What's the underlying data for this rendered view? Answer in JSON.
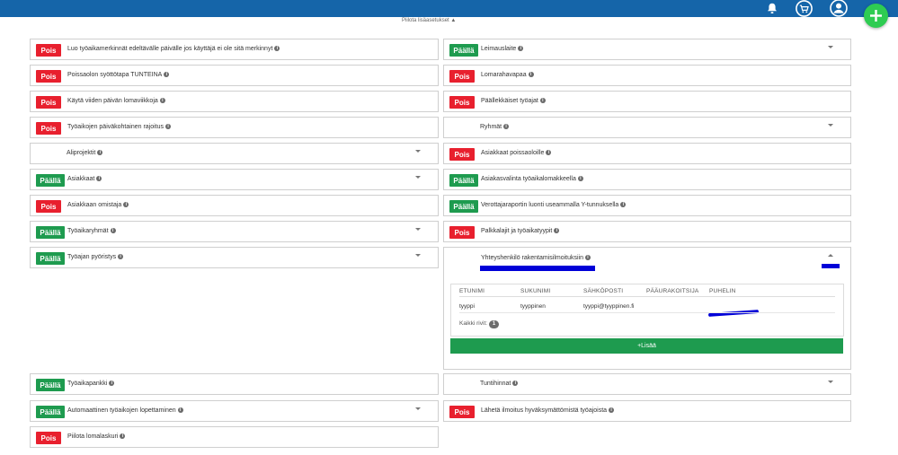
{
  "toggle": {
    "off": "Pois",
    "on": "Päällä"
  },
  "hide_settings": "Piilota lisäasetukset ▲",
  "info_glyph": "i",
  "settings_left": [
    "Luo työaikamerkinnät edeltävälle päivälle jos käyttäjä ei ole sitä merkinnyt",
    "Poissaolon syöttötapa TUNTEINA",
    "Käytä viiden päivän lomaviikkoja",
    "Työaikojen päiväkohtainen rajoitus",
    "Aliprojektit",
    "Asiakkaat",
    "Asiakkaan omistaja",
    "Työaikaryhmät",
    "Työajan pyöristys",
    "Työaikapankki",
    "Automaattinen työaikojen lopettaminen",
    "Piilota lomalaskuri"
  ],
  "settings_right": [
    "Leimauslaite",
    "Lomarahavapaa",
    "Päällekkäiset työajat",
    "Ryhmät",
    "Asiakkaat poissaoloille",
    "Asiakasvalinta työaikalomakkeella",
    "Verottajaraportin luonti useammalla Y-tunnuksella",
    "Palkkalajit ja työaikatyypit",
    "Yhteyshenkilö rakentamisilmoituksiin",
    "Tuntihinnat",
    "Lähetä ilmoitus hyväksymättömistä työajoista"
  ],
  "contact_table": {
    "columns": [
      "ETUNIMI",
      "SUKUNIMI",
      "SÄHKÖPOSTI",
      "PÄÄURAKOITSIJA",
      "PUHELIN"
    ],
    "rows": [
      {
        "first": "tyyppi",
        "last": "tyyppinen",
        "email": "tyyppi@tyyppinen.fi"
      }
    ],
    "total_label": "Kaikki rivit:",
    "total_count": "1",
    "add_label": "+Lisää"
  },
  "colors": {
    "topbar": "#1565a9",
    "off": "#e8202e",
    "on": "#1e9b4f",
    "fab": "#2ecc52",
    "redaction": "#0000d8"
  }
}
